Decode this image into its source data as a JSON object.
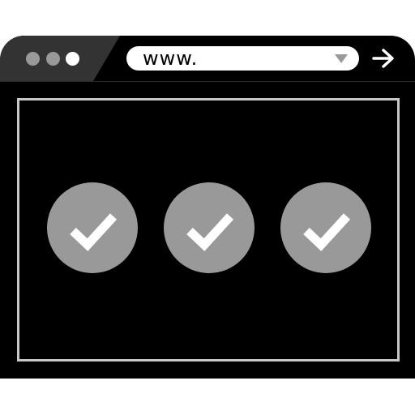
{
  "browser": {
    "window_dots": [
      {
        "color": "#999999"
      },
      {
        "color": "#999999"
      },
      {
        "color": "#ffffff"
      }
    ],
    "address_bar": {
      "value": "www.",
      "dropdown_icon": "triangle-down-icon"
    },
    "go_icon": "arrow-right-icon"
  },
  "content": {
    "status_items": [
      {
        "icon": "checkmark-icon",
        "state": "checked"
      },
      {
        "icon": "checkmark-icon",
        "state": "checked"
      },
      {
        "icon": "checkmark-icon",
        "state": "checked"
      }
    ]
  },
  "colors": {
    "window": "#000000",
    "toolbar_panel": "#333333",
    "check_circle": "#999999",
    "checkmark": "#ffffff",
    "frame_border": "#c8c8c8"
  }
}
